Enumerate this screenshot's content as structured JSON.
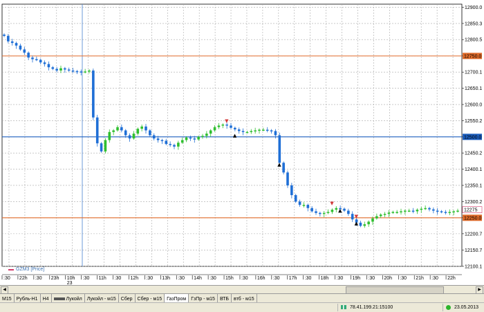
{
  "chart": {
    "symbol_legend": "GZM3 [Price]",
    "y_ticks": [
      "12900.0",
      "12850.3",
      "12800.5",
      "12750.0",
      "12700.1",
      "12650.1",
      "12600.0",
      "12550.2",
      "12500.0",
      "12450.2",
      "12400.1",
      "12350.1",
      "12300.2",
      "12250.0",
      "12200.7",
      "12150.7",
      "12100.1"
    ],
    "x_ticks": [
      ":30",
      "22h",
      ":30",
      "23h",
      "10h",
      ":30",
      "11h",
      ":30",
      "12h",
      ":30",
      "13h",
      ":30",
      "14h",
      ":30",
      "15h",
      ":30",
      "16h",
      ":30",
      "17h",
      ":30",
      "18h",
      ":30",
      "19h",
      ":30",
      "20h",
      ":30",
      "21h",
      ":30",
      "22h"
    ],
    "x_date_label": "23",
    "current_price_label": "12275",
    "hline_upper_label": "12750.0",
    "hline_lower_label": "12250.0",
    "hline_blue_label": "12500.0",
    "ylim": [
      12100,
      12910
    ],
    "colors": {
      "up_candle": "#2fbf2f",
      "down_candle": "#1f6fd6",
      "grid": "#a8a8a8",
      "orange_line": "#e06b2a",
      "blue_line": "#1c5fbf",
      "crosshair": "#5b8fd6"
    },
    "prices": [
      12812,
      12795,
      12790,
      12782,
      12770,
      12760,
      12745,
      12740,
      12738,
      12730,
      12725,
      12715,
      12710,
      12705,
      12712,
      12708,
      12705,
      12703,
      12702,
      12700,
      12702,
      12705,
      12560,
      12480,
      12455,
      12490,
      12515,
      12520,
      12530,
      12520,
      12505,
      12495,
      12510,
      12525,
      12532,
      12520,
      12505,
      12495,
      12490,
      12488,
      12478,
      12475,
      12470,
      12482,
      12490,
      12498,
      12495,
      12492,
      12500,
      12503,
      12510,
      12520,
      12530,
      12535,
      12538,
      12535,
      12528,
      12523,
      12518,
      12515,
      12515,
      12518,
      12520,
      12522,
      12522,
      12520,
      12518,
      12505,
      12420,
      12390,
      12350,
      12320,
      12300,
      12290,
      12290,
      12280,
      12270,
      12265,
      12262,
      12265,
      12268,
      12275,
      12280,
      12278,
      12272,
      12262,
      12245,
      12235,
      12225,
      12230,
      12238,
      12248,
      12255,
      12260,
      12262,
      12266,
      12268,
      12268,
      12270,
      12272,
      12272,
      12270,
      12275,
      12278,
      12280,
      12276,
      12272,
      12270,
      12268,
      12266,
      12268,
      12270,
      12272
    ]
  },
  "markers": {
    "arrow_down_label": "▼",
    "arrow_up_label": "▲"
  },
  "tabs": [
    {
      "label": "M15"
    },
    {
      "label": "Рубль-H1"
    },
    {
      "label": "H4"
    },
    {
      "label": "Лукойл"
    },
    {
      "label": "Лукойл - м15"
    },
    {
      "label": "Сбер"
    },
    {
      "label": "Сбер - м15"
    },
    {
      "label": "ГазПром"
    },
    {
      "label": "ГзПр - м15"
    },
    {
      "label": "ВТБ"
    },
    {
      "label": "втб - м15"
    }
  ],
  "active_tab": "ГазПром",
  "status": {
    "connection": "78.41.199.21:15100",
    "date": "23.05.2013"
  }
}
